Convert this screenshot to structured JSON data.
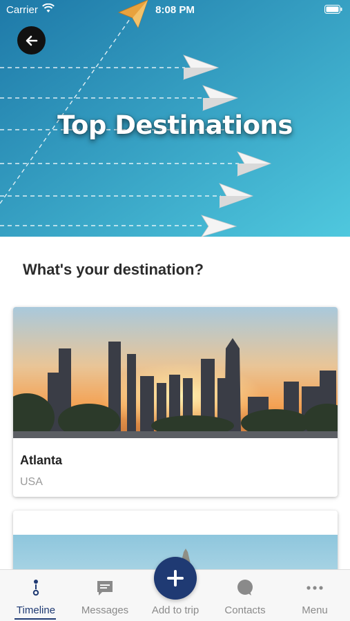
{
  "status_bar": {
    "carrier": "Carrier",
    "time": "8:08 PM",
    "wifi_icon": "wifi-icon",
    "battery_icon": "battery-icon"
  },
  "hero": {
    "title": "Top Destinations",
    "background_color": "#2aa0c8",
    "back_icon": "arrow-left-icon"
  },
  "section": {
    "heading": "What's your destination?"
  },
  "destinations": [
    {
      "name": "Atlanta",
      "country": "USA"
    }
  ],
  "tab_bar": {
    "accent_color": "#1f3a73",
    "items": [
      {
        "label": "Timeline",
        "icon": "timeline-icon",
        "active": true
      },
      {
        "label": "Messages",
        "icon": "message-icon",
        "active": false
      },
      {
        "label": "Add to trip",
        "icon": "plus-icon",
        "active": false
      },
      {
        "label": "Contacts",
        "icon": "contacts-icon",
        "active": false
      },
      {
        "label": "Menu",
        "icon": "more-icon",
        "active": false
      }
    ]
  }
}
